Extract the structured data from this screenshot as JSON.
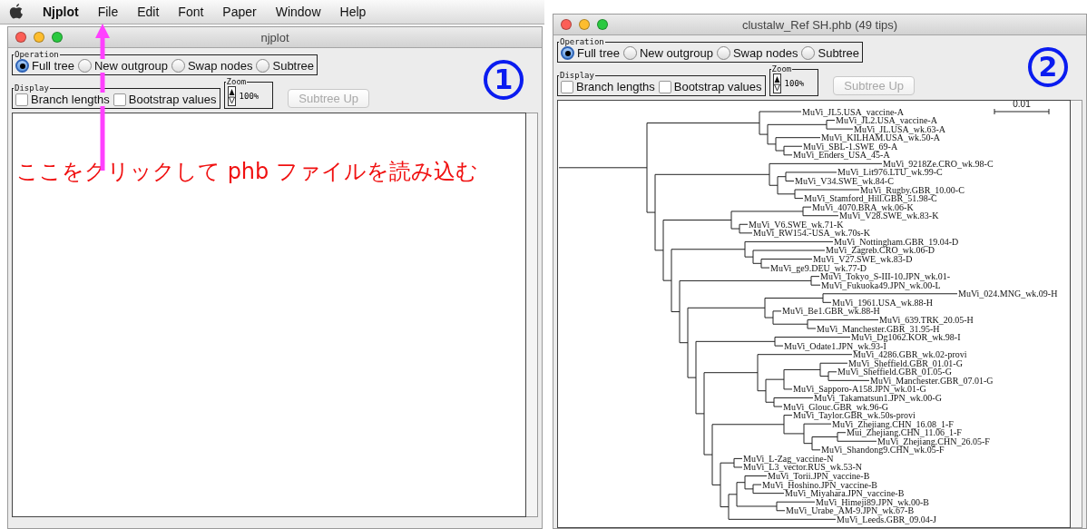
{
  "menu_bar": {
    "app": "Njplot",
    "items": [
      "File",
      "Edit",
      "Font",
      "Paper",
      "Window",
      "Help"
    ]
  },
  "windows": [
    {
      "title": "njplot",
      "badge": "1",
      "operation": {
        "label": "Operation",
        "options": [
          {
            "label": "Full tree",
            "selected": true
          },
          {
            "label": "New outgroup",
            "selected": false
          },
          {
            "label": "Swap nodes",
            "selected": false
          },
          {
            "label": "Subtree",
            "selected": false
          }
        ]
      },
      "display": {
        "label": "Display",
        "options": [
          {
            "label": "Branch lengths",
            "checked": false
          },
          {
            "label": "Bootstrap values",
            "checked": false
          }
        ]
      },
      "zoom": {
        "label": "Zoom",
        "value": "100%"
      },
      "subtree_up": {
        "label": "Subtree Up",
        "disabled": true
      }
    },
    {
      "title": "clustalw_Ref SH.phb (49 tips)",
      "badge": "2",
      "operation": {
        "label": "Operation",
        "options": [
          {
            "label": "Full tree",
            "selected": true
          },
          {
            "label": "New outgroup",
            "selected": false
          },
          {
            "label": "Swap nodes",
            "selected": false
          },
          {
            "label": "Subtree",
            "selected": false
          }
        ]
      },
      "display": {
        "label": "Display",
        "options": [
          {
            "label": "Branch lengths",
            "checked": false
          },
          {
            "label": "Bootstrap values",
            "checked": false
          }
        ]
      },
      "zoom": {
        "label": "Zoom",
        "value": "100%"
      },
      "subtree_up": {
        "label": "Subtree Up",
        "disabled": true
      },
      "tree": {
        "scale_label": "0.01",
        "root": {
          "children": [
            {
              "children": [
                {
                  "label": "MuVi_JL5.USA_vaccine-A"
                },
                {
                  "children": [
                    {
                      "children": [
                        {
                          "label": "MuVi_JL2.USA_vaccine-A"
                        },
                        {
                          "label": "MuVi_JL.USA_wk.63-A"
                        }
                      ]
                    },
                    {
                      "children": [
                        {
                          "label": "MuVi_KILHAM.USA_wk.50-A"
                        },
                        {
                          "children": [
                            {
                              "label": "MuVi_SBL-1.SWE_69-A"
                            },
                            {
                              "label": "MuVi_Enders_USA_45-A"
                            }
                          ]
                        }
                      ]
                    }
                  ]
                }
              ]
            },
            {
              "children": [
                {
                  "children": [
                    {
                      "label": "MuVi_9218Ze.CRO_wk.98-C"
                    },
                    {
                      "children": [
                        {
                          "children": [
                            {
                              "label": "MuVi_Lit976.LTU_wk.99-C"
                            },
                            {
                              "label": "MuVi_V34.SWE_wk.84-C"
                            }
                          ]
                        },
                        {
                          "children": [
                            {
                              "label": "MuVi_Rugby.GBR_10.00-C"
                            },
                            {
                              "label": "MuVi_Stamford_Hill.GBR_51.98-C"
                            }
                          ]
                        }
                      ]
                    }
                  ]
                },
                {
                  "children": [
                    {
                      "children": [
                        {
                          "children": [
                            {
                              "label": "MuVi_4070.BRA_wk.06-K"
                            },
                            {
                              "label": "MuVi_V28.SWE_wk.83-K"
                            }
                          ]
                        },
                        {
                          "children": [
                            {
                              "label": "MuVi_V6.SWE_wk.71-K"
                            },
                            {
                              "label": "MuVi_RW154.-USA_wk.70s-K"
                            }
                          ]
                        }
                      ]
                    },
                    {
                      "children": [
                        {
                          "children": [
                            {
                              "label": "MuVi_Nottingham.GBR_19.04-D"
                            },
                            {
                              "children": [
                                {
                                  "label": "MuVi_Zagreb.CRO_wk.06-D"
                                },
                                {
                                  "children": [
                                    {
                                      "label": "MuVi_V27.SWE_wk.83-D"
                                    },
                                    {
                                      "label": "MuVi_ge9.DEU_wk.77-D"
                                    }
                                  ]
                                }
                              ]
                            }
                          ]
                        },
                        {
                          "children": [
                            {
                              "children": [
                                {
                                  "label": "MuVi_Tokyo_S-III-10.JPN_wk.01-"
                                },
                                {
                                  "label": "MuVi_Fukuoka49.JPN_wk.00-L"
                                }
                              ]
                            },
                            {
                              "children": [
                                {
                                  "children": [
                                    {
                                      "children": [
                                        {
                                          "label": "MuVi_024.MNG_wk.09-H"
                                        },
                                        {
                                          "label": "MuVi_1961.USA_wk.88-H"
                                        }
                                      ]
                                    },
                                    {
                                      "children": [
                                        {
                                          "label": "MuVi_Be1.GBR_wk.88-H"
                                        },
                                        {
                                          "children": [
                                            {
                                              "label": "MuVi_639.TRK_20.05-H"
                                            },
                                            {
                                              "label": "MuVi_Manchester.GBR_31.95-H"
                                            }
                                          ]
                                        }
                                      ]
                                    }
                                  ]
                                },
                                {
                                  "children": [
                                    {
                                      "children": [
                                        {
                                          "label": "MuVi_Dg1062.KOR_wk.98-I"
                                        },
                                        {
                                          "label": "MuVi_Odate1.JPN_wk.93-I"
                                        }
                                      ]
                                    },
                                    {
                                      "children": [
                                        {
                                          "children": [
                                            {
                                              "label": "MuVi_4286.GBR_wk.02-provi"
                                            },
                                            {
                                              "children": [
                                                {
                                                  "children": [
                                                    {
                                                      "children": [
                                                        {
                                                          "label": "MuVi_Sheffield.GBR_01.01-G"
                                                        },
                                                        {
                                                          "children": [
                                                            {
                                                              "label": "MuVi_Sheffield.GBR_01.05-G"
                                                            },
                                                            {
                                                              "label": "MuVi_Manchester.GBR_07.01-G"
                                                            }
                                                          ]
                                                        }
                                                      ]
                                                    },
                                                    {
                                                      "label": "MuVi_Sapporo-A158.JPN_wk.01-G"
                                                    }
                                                  ]
                                                },
                                                {
                                                  "children": [
                                                    {
                                                      "label": "MuVi_Takamatsun1.JPN_wk.00-G"
                                                    },
                                                    {
                                                      "label": "MuVi_Glouc.GBR_wk.96-G"
                                                    }
                                                  ]
                                                }
                                              ]
                                            }
                                          ]
                                        },
                                        {
                                          "children": [
                                            {
                                              "children": [
                                                {
                                                  "label": "MuVi_Taylor.GBR_wk.50s-provi"
                                                },
                                                {
                                                  "children": [
                                                    {
                                                      "label": "MuVi_Zhejiang.CHN_16.08_1-F"
                                                    },
                                                    {
                                                      "children": [
                                                        {
                                                          "children": [
                                                            {
                                                              "label": "Mui_Zhejiang.CHN_11.06_1-F"
                                                            },
                                                            {
                                                              "label": "MuVi_Zhejiang.CHN_26.05-F"
                                                            }
                                                          ]
                                                        },
                                                        {
                                                          "label": "MuVi_Shandong9.CHN_wk.05-F"
                                                        }
                                                      ]
                                                    }
                                                  ]
                                                }
                                              ]
                                            },
                                            {
                                              "children": [
                                                {
                                                  "children": [
                                                    {
                                                      "label": "MuVi_L-Zag_vaccine-N"
                                                    },
                                                    {
                                                      "label": "MuVi_L3_vector.RUS_wk.53-N"
                                                    }
                                                  ]
                                                },
                                                {
                                                  "children": [
                                                    {
                                                      "children": [
                                                        {
                                                          "children": [
                                                            {
                                                              "label": "MuVi_Torii.JPN_vaccine-B"
                                                            },
                                                            {
                                                              "children": [
                                                                {
                                                                  "label": "MuVi_Hoshino.JPN_vaccine-B"
                                                                },
                                                                {
                                                                  "label": "MuVi_Miyahara.JPN_vaccine-B"
                                                                }
                                                              ]
                                                            }
                                                          ]
                                                        },
                                                        {
                                                          "children": [
                                                            {
                                                              "label": "MuVi_Himeji89.JPN_wk.00-B"
                                                            },
                                                            {
                                                              "label": "MuVi_Urabe_AM-9.JPN_wk.67-B"
                                                            }
                                                          ]
                                                        }
                                                      ]
                                                    },
                                                    {
                                                      "children": [
                                                        {
                                                          "label": "MuVi_Leeds.GBR_09.04-J"
                                                        }
                                                      ]
                                                    }
                                                  ]
                                                }
                                              ]
                                            }
                                          ]
                                        }
                                      ]
                                    }
                                  ]
                                }
                              ]
                            }
                          ]
                        }
                      ]
                    }
                  ]
                }
              ]
            }
          ]
        }
      }
    }
  ],
  "annotation": {
    "text": "ここをクリックして phb ファイルを読み込む"
  }
}
